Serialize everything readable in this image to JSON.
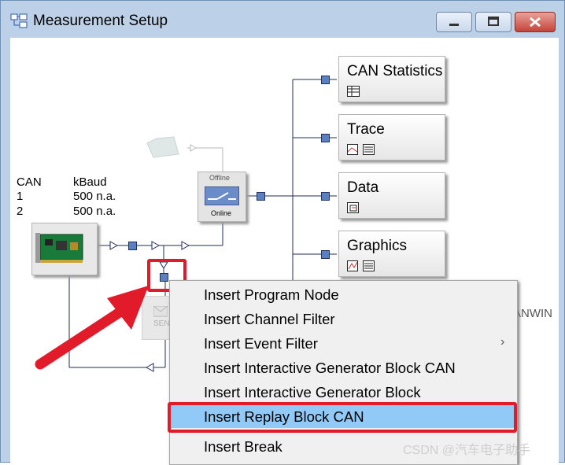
{
  "window": {
    "title": "Measurement Setup",
    "controls": {
      "minimize": "–",
      "maximize": "□",
      "close": "✕"
    }
  },
  "channels": {
    "headers": [
      "CAN",
      "kBaud"
    ],
    "rows": [
      {
        "channel": "1",
        "baud": "500 n.a."
      },
      {
        "channel": "2",
        "baud": "500 n.a."
      }
    ]
  },
  "offline_online": {
    "top_label": "Offline",
    "bottom_label": "Online"
  },
  "send_block": {
    "label": "SEN"
  },
  "blocks": [
    {
      "title": "CAN Statistics"
    },
    {
      "title": "Trace"
    },
    {
      "title": "Data"
    },
    {
      "title": "Graphics"
    }
  ],
  "partial_text": "ANWIN",
  "context_menu": {
    "items": [
      {
        "label": "Insert Program Node",
        "selected": false,
        "submenu": false
      },
      {
        "label": "Insert Channel Filter",
        "selected": false,
        "submenu": false
      },
      {
        "label": "Insert Event Filter",
        "selected": false,
        "submenu": true
      },
      {
        "label": "Insert Interactive Generator Block CAN",
        "selected": false,
        "submenu": false
      },
      {
        "label": "Insert Interactive Generator Block",
        "selected": false,
        "submenu": false
      },
      {
        "label": "Insert Replay Block CAN",
        "selected": true,
        "submenu": false
      },
      {
        "label": "Insert Break",
        "selected": false,
        "submenu": false
      }
    ]
  },
  "watermark": "CSDN @汽车电子助手",
  "colors": {
    "highlight": "#91c9f7",
    "annotation_red": "#e11b2a",
    "node_blue": "#5b7fc1"
  }
}
